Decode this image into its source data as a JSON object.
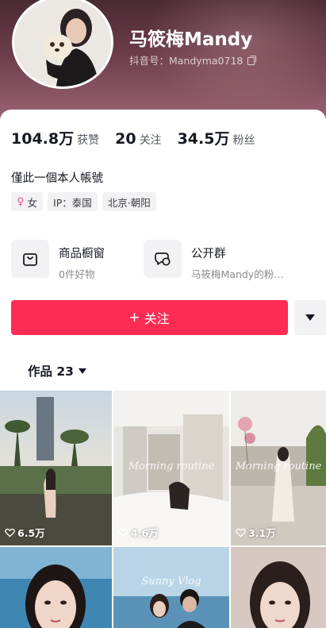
{
  "profile": {
    "name": "马筱梅Mandy",
    "douyin_id": "抖音号：Mandyma0718"
  },
  "stats": [
    {
      "value": "104.8万",
      "label": "获赞"
    },
    {
      "value": "20",
      "label": "关注"
    },
    {
      "value": "34.5万",
      "label": "粉丝"
    }
  ],
  "bio": "僅此一個本人帳號",
  "tags": {
    "gender_symbol": "♀",
    "gender": "女",
    "ip": "IP：泰国",
    "location": "北京·朝阳"
  },
  "features": {
    "shop": {
      "title": "商品橱窗",
      "subtitle": "0件好物",
      "icon": "shop-bag-icon"
    },
    "group": {
      "title": "公开群",
      "subtitle": "马筱梅Mandy的粉…",
      "icon": "chat-bubble-icon"
    }
  },
  "actions": {
    "follow_plus": "+",
    "follow_label": "关注"
  },
  "works_tab": {
    "label": "作品 23"
  },
  "videos": [
    {
      "likes": "6.5万"
    },
    {
      "likes": "4.6万",
      "overlay": "Morning routine"
    },
    {
      "likes": "3.1万",
      "overlay": "Morning routine"
    },
    {
      "likes": ""
    },
    {
      "likes": "",
      "overlay": "Sunny Vlog"
    },
    {
      "likes": ""
    }
  ],
  "colors": {
    "follow_button": "#fe2c55",
    "header": "#6b3d49"
  }
}
